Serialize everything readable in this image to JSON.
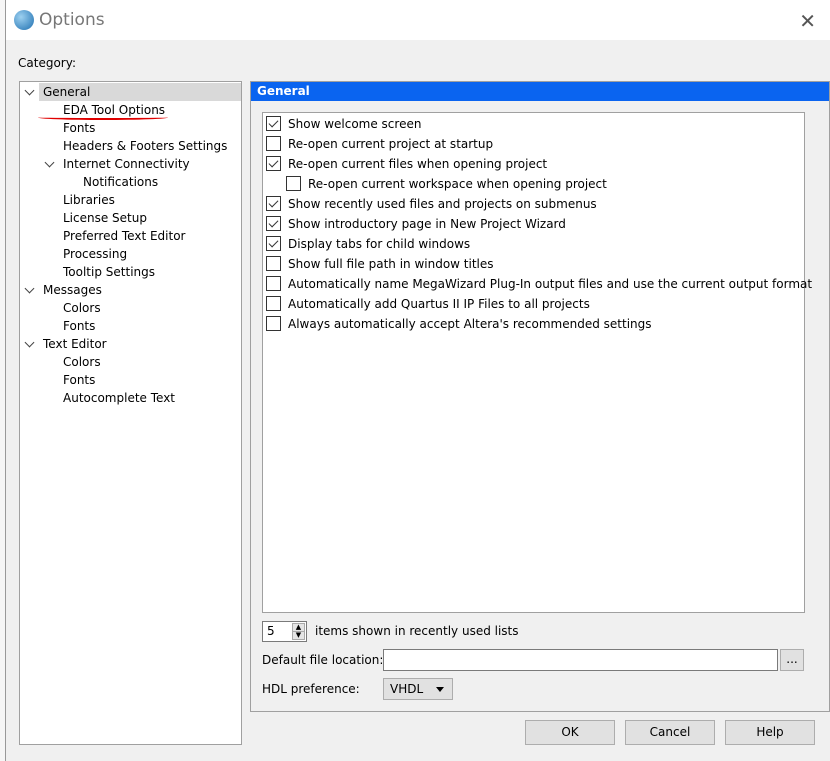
{
  "window": {
    "title": "Options",
    "close_icon": "close-icon",
    "logo_icon": "quartus-globe-icon"
  },
  "category_label": "Category:",
  "tree": [
    {
      "label": "General",
      "level": 0,
      "expanded": true,
      "selected": true
    },
    {
      "label": "EDA Tool Options",
      "level": 1,
      "annotated": true
    },
    {
      "label": "Fonts",
      "level": 1
    },
    {
      "label": "Headers & Footers Settings",
      "level": 1
    },
    {
      "label": "Internet Connectivity",
      "level": 1,
      "expanded": true
    },
    {
      "label": "Notifications",
      "level": 2
    },
    {
      "label": "Libraries",
      "level": 1
    },
    {
      "label": "License Setup",
      "level": 1
    },
    {
      "label": "Preferred Text Editor",
      "level": 1
    },
    {
      "label": "Processing",
      "level": 1
    },
    {
      "label": "Tooltip Settings",
      "level": 1
    },
    {
      "label": "Messages",
      "level": 0,
      "expanded": true
    },
    {
      "label": "Colors",
      "level": 1
    },
    {
      "label": "Fonts",
      "level": 1
    },
    {
      "label": "Text Editor",
      "level": 0,
      "expanded": true
    },
    {
      "label": "Colors",
      "level": 1
    },
    {
      "label": "Fonts",
      "level": 1
    },
    {
      "label": "Autocomplete Text",
      "level": 1
    }
  ],
  "panel": {
    "header": "General",
    "header_color": "#0a64f0",
    "options": [
      {
        "label": "Show welcome screen",
        "checked": true,
        "indent": 0
      },
      {
        "label": "Re-open current project at startup",
        "checked": false,
        "indent": 0
      },
      {
        "label": "Re-open current files when opening project",
        "checked": true,
        "indent": 0
      },
      {
        "label": "Re-open current workspace when opening project",
        "checked": false,
        "indent": 1
      },
      {
        "label": "Show recently used files and projects on submenus",
        "checked": true,
        "indent": 0
      },
      {
        "label": "Show introductory page in New Project Wizard",
        "checked": true,
        "indent": 0
      },
      {
        "label": "Display tabs for child windows",
        "checked": true,
        "indent": 0
      },
      {
        "label": "Show full file path in window titles",
        "checked": false,
        "indent": 0
      },
      {
        "label": "Automatically name MegaWizard Plug-In output files and use the current output format",
        "checked": false,
        "indent": 0
      },
      {
        "label": "Automatically add Quartus II IP Files to all projects",
        "checked": false,
        "indent": 0
      },
      {
        "label": "Always automatically accept Altera's recommended settings",
        "checked": false,
        "indent": 0
      }
    ],
    "recent_count": "5",
    "recent_label": "items shown in recently used lists",
    "file_location_label": "Default file location:",
    "file_location_value": "",
    "browse_label": "...",
    "hdl_label": "HDL preference:",
    "hdl_value": "VHDL"
  },
  "buttons": {
    "ok": "OK",
    "cancel": "Cancel",
    "help": "Help"
  }
}
